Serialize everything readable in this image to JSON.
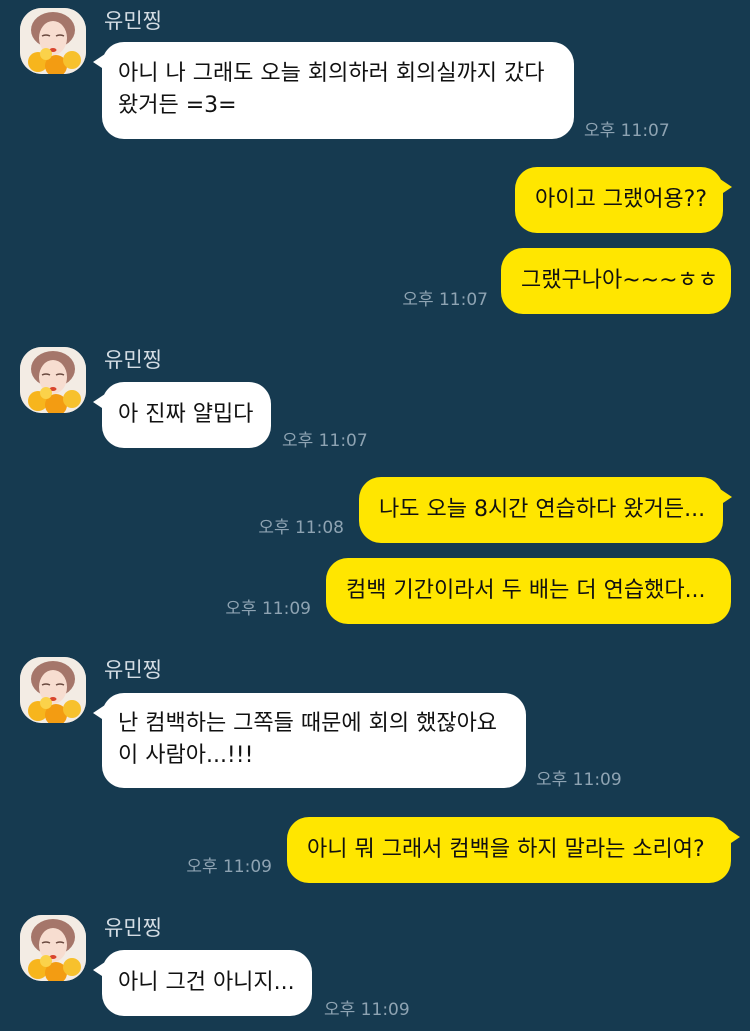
{
  "colors": {
    "background": "#163a50",
    "incoming_bubble": "#ffffff",
    "outgoing_bubble": "#ffe600",
    "timestamp": "#8ea3b2",
    "sender_name": "#d4dde4"
  },
  "sender": {
    "name": "유민찡",
    "avatar_icon": "profile-photo-avatar"
  },
  "messages": [
    {
      "lines": [
        "아니 나 그래도 오늘 회의하러 회의실까지 갔다",
        "왔거든 =3="
      ],
      "time": "오후 11:07"
    },
    {
      "lines": [
        "아이고 그랬어용??"
      ]
    },
    {
      "lines": [
        "그랬구나아~~~ㅎㅎ"
      ],
      "time": "오후 11:07"
    },
    {
      "lines": [
        "아 진짜 얄밉다"
      ],
      "time": "오후 11:07"
    },
    {
      "lines": [
        "나도 오늘 8시간 연습하다 왔거든..."
      ],
      "time": "오후 11:08"
    },
    {
      "lines": [
        "컴백 기간이라서 두 배는 더 연습했다..."
      ],
      "time": "오후 11:09"
    },
    {
      "lines": [
        "난 컴백하는 그쪽들 때문에 회의 했잖아요",
        "이 사람아...!!!"
      ],
      "time": "오후 11:09"
    },
    {
      "lines": [
        "아니 뭐 그래서 컴백을 하지 말라는 소리여?"
      ],
      "time": "오후 11:09"
    },
    {
      "lines": [
        "아니 그건 아니지..."
      ],
      "time": "오후 11:09"
    }
  ]
}
